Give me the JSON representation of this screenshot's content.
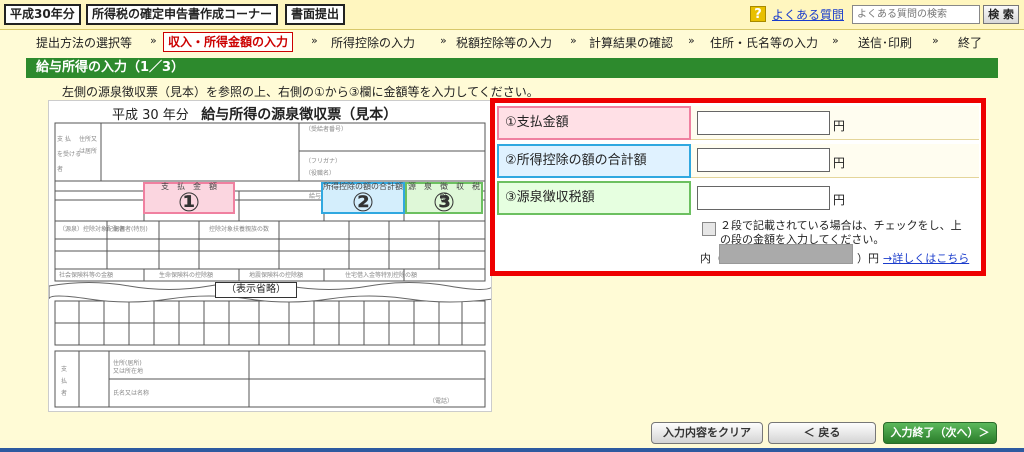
{
  "header": {
    "era_tag": "平成30年分",
    "corner_title": "所得税の確定申告書作成コーナー",
    "submit_tag": "書面提出",
    "faq_link": "よくある質問",
    "search_placeholder": "よくある質問の検索",
    "search_button": "検 索"
  },
  "steps": [
    "提出方法の選択等",
    "収入・所得金額の入力",
    "所得控除の入力",
    "税額控除等の入力",
    "計算結果の確認",
    "住所・氏名等の入力",
    "送信･印刷",
    "終了"
  ],
  "step_arrow": "»",
  "page_title": "給与所得の入力（1／3）",
  "instruction": "左側の源泉徴収票（見本）を参照の上、右側の①から③欄に金額等を入力してください。",
  "slip": {
    "title_year": "平成 30 年分",
    "title_main": "給与所得の源泉徴収票（見本）",
    "col_payment": "支　払　金　額",
    "col_deduction": "所得控除の額の合計額",
    "col_tax": "源　泉　徴　収　税　額",
    "mark1": "①",
    "mark2": "②",
    "mark3": "③",
    "omitted": "（表示省略）"
  },
  "form": {
    "row1_label": "①支払金額",
    "row2_label": "②所得控除の額の合計額",
    "row3_label": "③源泉徴収税額",
    "row1_value": "",
    "row2_value": "",
    "row3_value": "",
    "yen": "円",
    "checkbox_text": "２段で記載されている場合は、チェックをし、上の段の金額を入力してください。",
    "inner_label": "内（",
    "inner_yen": "）円",
    "detail_link": "→詳しくはこちら"
  },
  "buttons": {
    "clear": "入力内容をクリア",
    "back": "＜ 戻る",
    "next": "入力終了（次へ）＞"
  },
  "colors": {
    "title_bar": "#2d8a2d",
    "highlight_frame": "#e00000",
    "mark1": "#f080a0",
    "mark2": "#30a8e0",
    "mark3": "#6cc060"
  }
}
